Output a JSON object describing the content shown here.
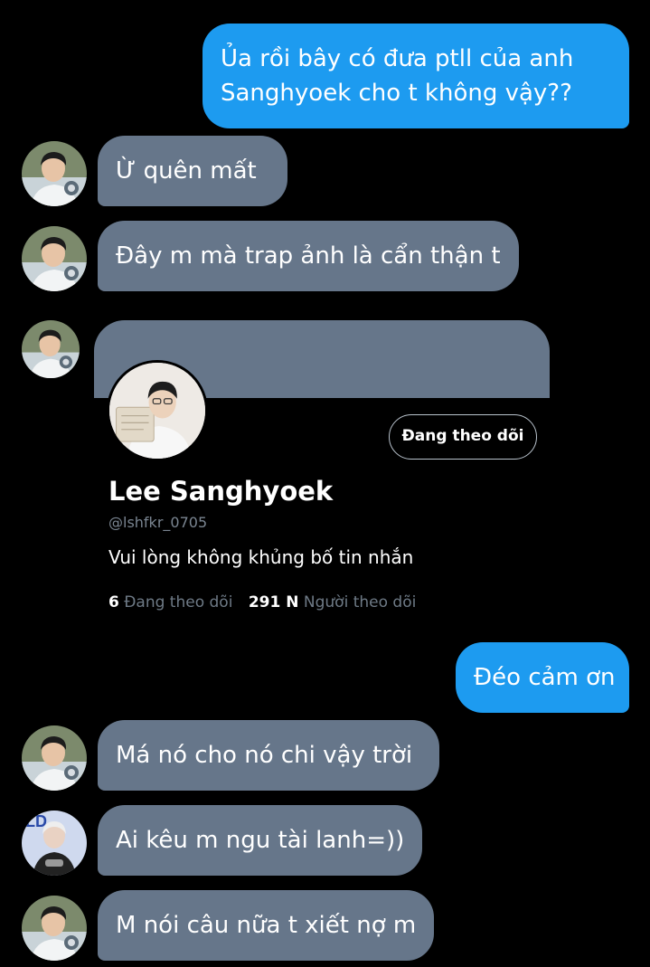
{
  "messages": [
    {
      "text": "Ủa rồi bây có đưa ptll của anh Sanghyoek cho t không vậy??",
      "direction": "outgoing"
    },
    {
      "text": "Ừ quên mất",
      "direction": "incoming",
      "sender": "friend-1"
    },
    {
      "text": "Đây m mà trap ảnh là cẩn thận t",
      "direction": "incoming",
      "sender": "friend-1"
    },
    {
      "text": "Đéo cảm ơn",
      "direction": "outgoing"
    },
    {
      "text": "Má nó cho nó chi vậy trời",
      "direction": "incoming",
      "sender": "friend-1"
    },
    {
      "text": "Ai kêu m ngu tài lanh=))",
      "direction": "incoming",
      "sender": "friend-2"
    },
    {
      "text": "M nói câu nữa t xiết nợ m",
      "direction": "incoming",
      "sender": "friend-1"
    }
  ],
  "profile_card": {
    "name": "Lee Sanghyoek",
    "handle": "@lshfkr_0705",
    "bio": "Vui lòng không khủng bố tin nhắn",
    "following_count": "6",
    "following_label": "Đang theo dõi",
    "followers_count": "291 N",
    "followers_label": "Người theo dõi",
    "follow_button": "Đang theo dõi"
  },
  "colors": {
    "background": "#000000",
    "outgoing_bubble": "#1d9bf0",
    "incoming_bubble": "#66768a",
    "muted_text": "#7a8591"
  }
}
